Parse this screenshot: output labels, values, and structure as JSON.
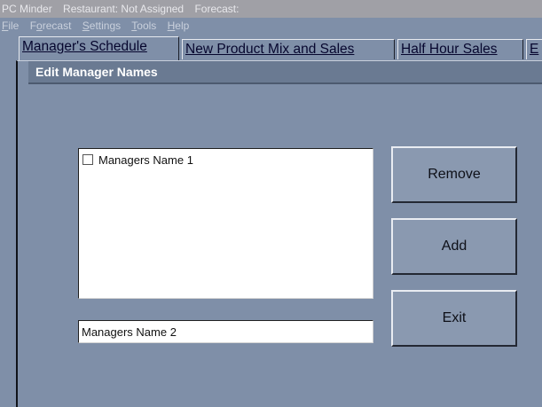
{
  "titlebar": {
    "app": "PC Minder",
    "restaurant": "Restaurant: Not Assigned",
    "forecast": "Forecast:"
  },
  "menu": [
    {
      "label": "File",
      "accel": "F",
      "rest": "ile"
    },
    {
      "label": "Forecast",
      "accel_prefix": "F",
      "accel": "o",
      "rest": "recast"
    },
    {
      "label": "Settings",
      "accel": "S",
      "rest": "ettings"
    },
    {
      "label": "Tools",
      "accel": "T",
      "rest": "ools"
    },
    {
      "label": "Help",
      "accel": "H",
      "rest": "elp"
    }
  ],
  "tabs": [
    {
      "label": "Manager's Schedule",
      "active": true
    },
    {
      "label": "New Product Mix and Sales",
      "active": false
    },
    {
      "label": "Half Hour Sales",
      "active": false
    },
    {
      "label": "E",
      "active": false
    }
  ],
  "dialog": {
    "title": "Edit Manager Names",
    "list_items": [
      "Managers Name 1"
    ],
    "name_input_value": "Managers Name 2",
    "buttons": {
      "remove": "Remove",
      "add": "Add",
      "exit": "Exit"
    }
  }
}
